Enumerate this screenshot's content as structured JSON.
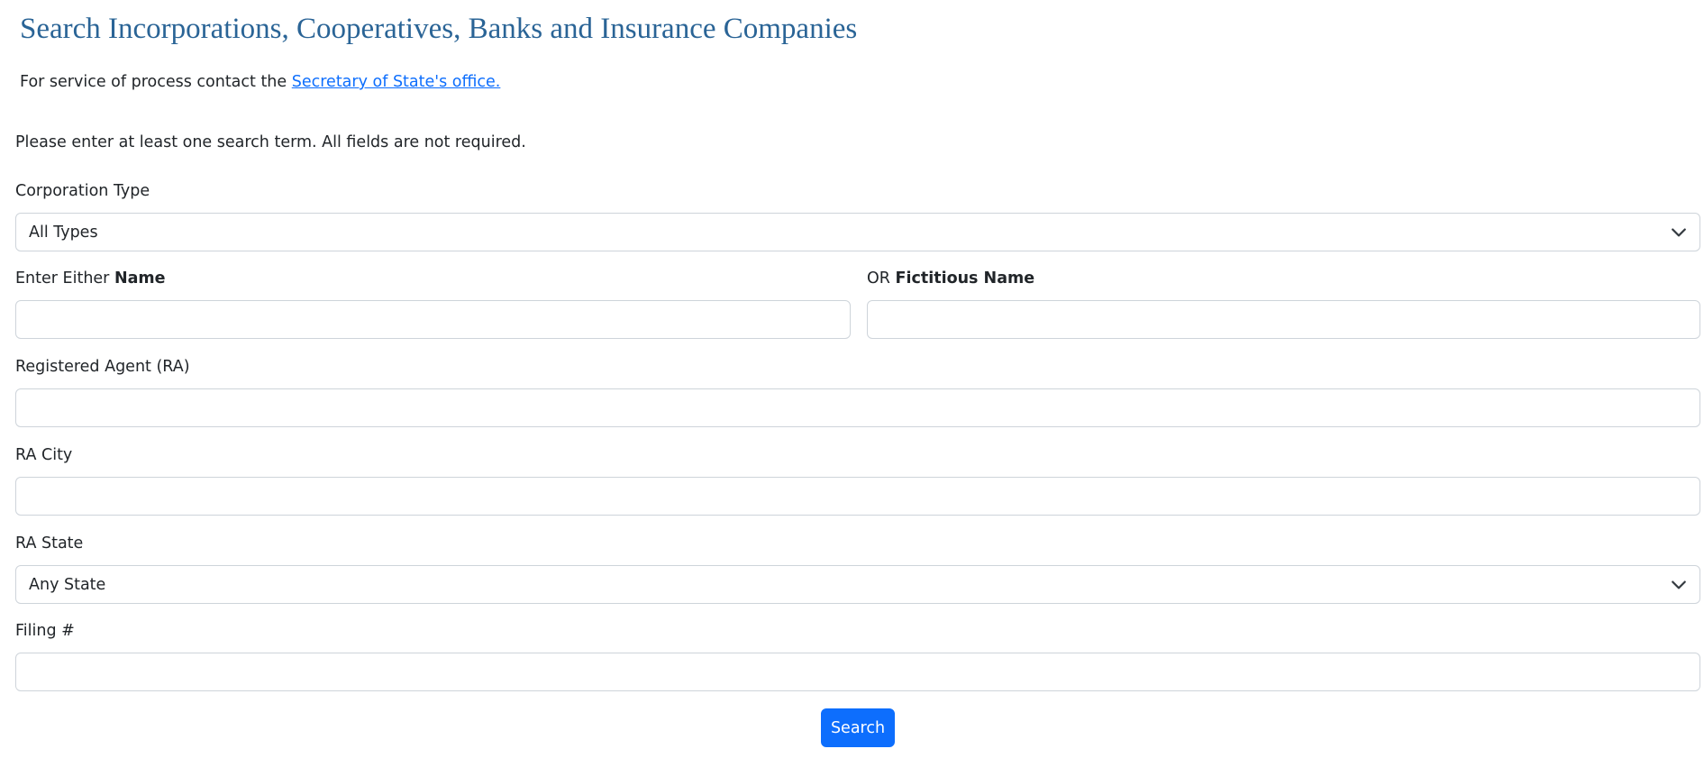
{
  "header": {
    "title": "Search Incorporations, Cooperatives, Banks and Insurance Companies",
    "service_prefix": "For service of process contact the",
    "service_link": "Secretary of State's office."
  },
  "notice": "Please enter at least one search term. All fields are not required.",
  "form": {
    "corporation_type": {
      "label": "Corporation Type",
      "selected": "All Types"
    },
    "name": {
      "label_prefix": "Enter Either",
      "label_bold": "Name",
      "value": ""
    },
    "fictitious_name": {
      "label_prefix": "OR",
      "label_bold": "Fictitious Name",
      "value": ""
    },
    "registered_agent": {
      "label": "Registered Agent (RA)",
      "value": ""
    },
    "ra_city": {
      "label": "RA City",
      "value": ""
    },
    "ra_state": {
      "label": "RA State",
      "selected": "Any State"
    },
    "filing_number": {
      "label": "Filing #",
      "value": ""
    },
    "search_button": "Search"
  },
  "icons": {
    "select_chevron": "chevron-down-icon"
  },
  "colors": {
    "title": "#2a6496",
    "link": "#0d6efd",
    "button": "#0d6efd",
    "border": "#ced4da"
  }
}
